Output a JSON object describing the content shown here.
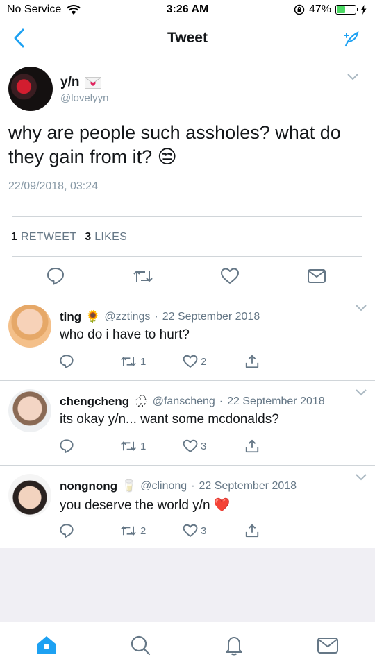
{
  "status_bar": {
    "carrier": "No Service",
    "time": "3:26 AM",
    "battery": "47%",
    "battery_level": 0.47
  },
  "nav": {
    "title": "Tweet"
  },
  "tweet": {
    "author_name": "y/n",
    "author_handle": "@lovelyyn",
    "text": "why are people such assholes? what do they gain from it?",
    "emoji": "😒",
    "date": "22/09/2018, 03:24",
    "retweets_count": "1",
    "retweets_label": "RETWEET",
    "likes_count": "3",
    "likes_label": "LIKES"
  },
  "replies": [
    {
      "name": "ting",
      "emoji": "🌻",
      "handle": "@zztings",
      "date": "22 September 2018",
      "text": "who do i have to hurt?",
      "retweets": "1",
      "likes": "2"
    },
    {
      "name": "chengcheng",
      "emoji": "🌧",
      "handle": "@fanscheng",
      "date": "22 September 2018",
      "text": "its okay y/n... want some mcdonalds?",
      "retweets": "1",
      "likes": "3"
    },
    {
      "name": "nongnong",
      "emoji": "🥛",
      "handle": "@clinong",
      "date": "22 September 2018",
      "text": "you deserve the world y/n",
      "text_emoji": "❤️",
      "retweets": "2",
      "likes": "3"
    }
  ],
  "colors": {
    "accent": "#1da1f2",
    "muted": "#657786",
    "light_muted": "#8899a6",
    "divider": "#d0d5d9",
    "battery": "#4cd964"
  },
  "icons": [
    "back-chevron-icon",
    "compose-icon",
    "reply-icon",
    "retweet-icon",
    "like-icon",
    "dm-icon",
    "share-icon",
    "home-icon",
    "search-icon",
    "notifications-icon",
    "messages-icon"
  ]
}
